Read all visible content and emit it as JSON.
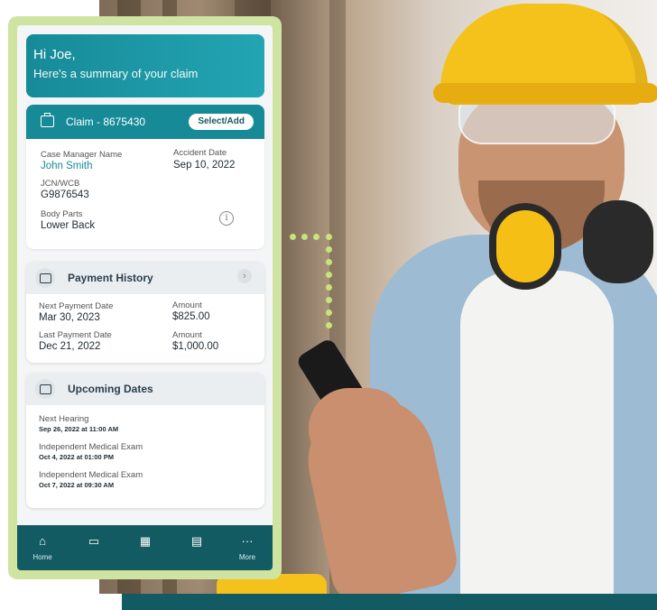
{
  "greeting": {
    "line1": "Hi Joe,",
    "line2": "Here's a summary of your claim"
  },
  "claim": {
    "title": "Claim - 8675430",
    "select_label": "Select/Add",
    "case_manager_label": "Case Manager Name",
    "case_manager_value": "John Smith",
    "accident_date_label": "Accident Date",
    "accident_date_value": "Sep 10, 2022",
    "jcn_label": "JCN/WCB",
    "jcn_value": "G9876543",
    "body_parts_label": "Body Parts",
    "body_parts_value": "Lower Back"
  },
  "payment_history": {
    "title": "Payment History",
    "next_label": "Next Payment Date",
    "next_value": "Mar 30, 2023",
    "next_amount_label": "Amount",
    "next_amount_value": "$825.00",
    "last_label": "Last Payment Date",
    "last_value": "Dec 21, 2022",
    "last_amount_label": "Amount",
    "last_amount_value": "$1,000.00"
  },
  "upcoming_dates": {
    "title": "Upcoming Dates",
    "items": [
      {
        "label": "Next Hearing",
        "value": "Sep 26, 2022 at 11:00 AM"
      },
      {
        "label": "Independent Medical Exam",
        "value": "Oct 4, 2022 at 01:00 PM"
      },
      {
        "label": "Independent Medical Exam",
        "value": "Oct 7, 2022 at 09:30 AM"
      }
    ]
  },
  "nav": {
    "items": [
      {
        "label": "Home",
        "icon": "home-icon"
      },
      {
        "label": "",
        "icon": "payments-icon"
      },
      {
        "label": "",
        "icon": "medical-icon"
      },
      {
        "label": "",
        "icon": "notifications-icon"
      },
      {
        "label": "More",
        "icon": "more-icon"
      }
    ]
  },
  "colors": {
    "primary": "#178a98",
    "dark_teal": "#135b63",
    "frame": "#cfe4a0",
    "hat": "#f5c21c"
  }
}
